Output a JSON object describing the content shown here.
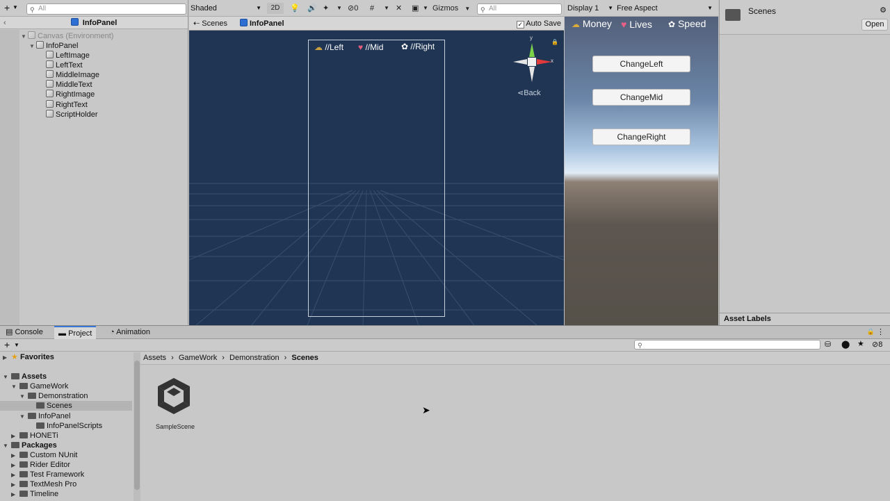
{
  "hierarchy": {
    "search_placeholder": "All",
    "title": "InfoPanel",
    "items": [
      {
        "label": "Canvas (Environment)"
      },
      {
        "label": "InfoPanel"
      },
      {
        "label": "LeftImage"
      },
      {
        "label": "LeftText"
      },
      {
        "label": "MiddleImage"
      },
      {
        "label": "MiddleText"
      },
      {
        "label": "RightImage"
      },
      {
        "label": "RightText"
      },
      {
        "label": "ScriptHolder"
      }
    ]
  },
  "scene": {
    "shading_mode": "Shaded",
    "mode_2d": "2D",
    "hidden_count": "0",
    "gizmos": "Gizmos",
    "search_placeholder": "All",
    "breadcrumb_root": "Scenes",
    "breadcrumb_prefab": "InfoPanel",
    "auto_save": "Auto Save",
    "labels": {
      "left": "//Left",
      "mid": "//Mid",
      "right": "//Right"
    },
    "gizmo_y": "y",
    "gizmo_x": "x",
    "back": "Back"
  },
  "game": {
    "display": "Display 1",
    "aspect": "Free Aspect",
    "hud": {
      "money": "Money",
      "lives": "Lives",
      "speed": "Speed"
    },
    "buttons": {
      "left": "ChangeLeft",
      "mid": "ChangeMid",
      "right": "ChangeRight"
    }
  },
  "inspector": {
    "title": "Scenes",
    "open": "Open",
    "asset_labels": "Asset Labels"
  },
  "bottom": {
    "tabs": {
      "console": "Console",
      "project": "Project",
      "animation": "Animation"
    },
    "hidden_count": "8",
    "breadcrumb": [
      "Assets",
      "GameWork",
      "Demonstration",
      "Scenes"
    ],
    "tree": {
      "favorites": "Favorites",
      "assets": "Assets",
      "gamework": "GameWork",
      "demonstration": "Demonstration",
      "scenes": "Scenes",
      "infopanel": "InfoPanel",
      "infopanel_scripts": "InfoPanelScripts",
      "honeti": "HONETi",
      "packages": "Packages",
      "custom_nunit": "Custom NUnit",
      "rider_editor": "Rider Editor",
      "test_framework": "Test Framework",
      "textmesh_pro": "TextMesh Pro",
      "timeline": "Timeline"
    },
    "asset": "SampleScene"
  }
}
